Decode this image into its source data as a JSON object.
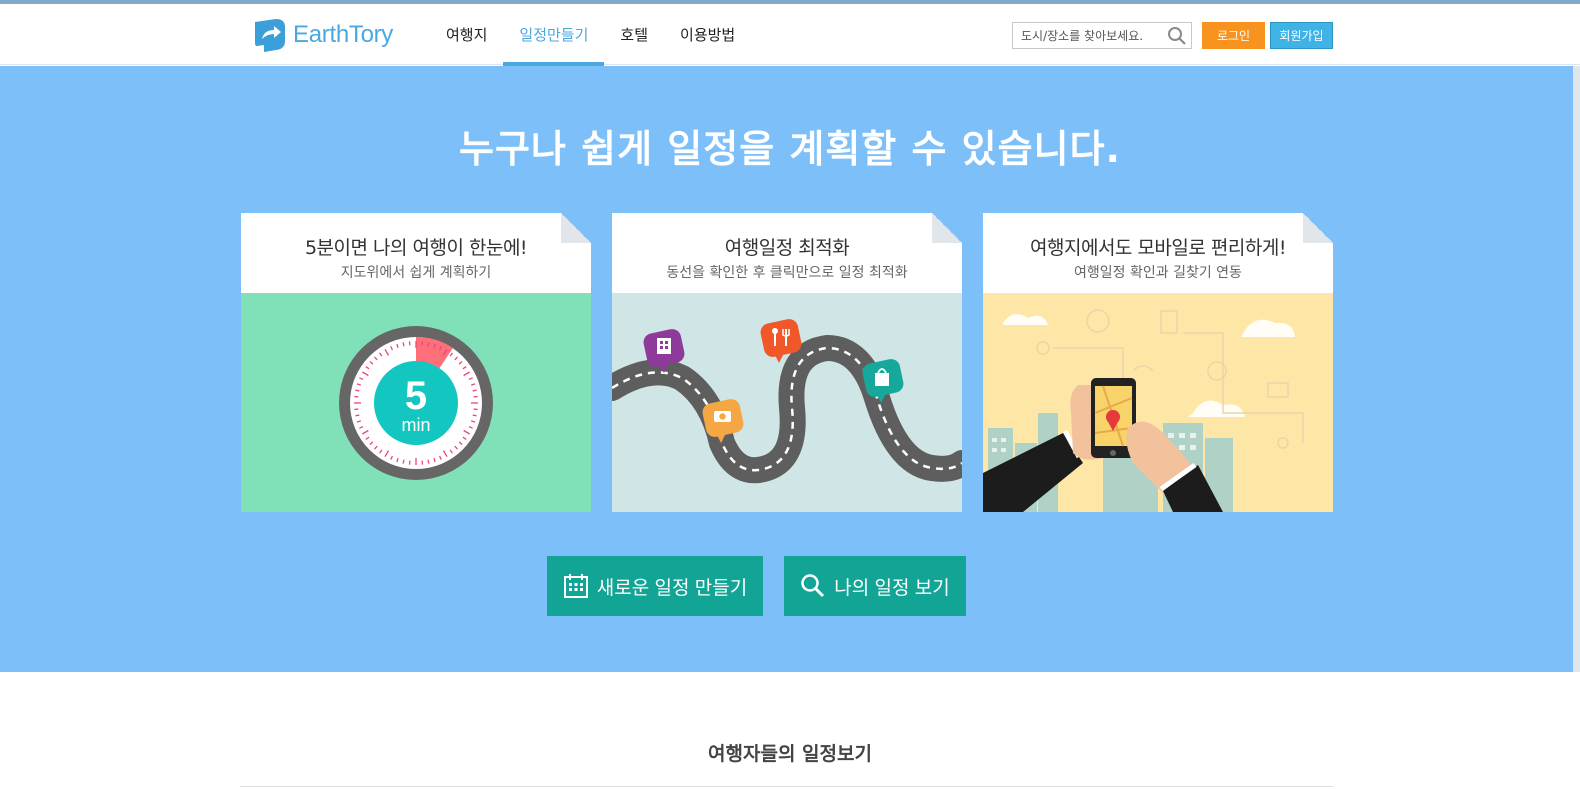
{
  "header": {
    "logo_text": "EarthTory",
    "nav": [
      {
        "label": "여행지"
      },
      {
        "label": "일정만들기"
      },
      {
        "label": "호텔"
      },
      {
        "label": "이용방법"
      }
    ],
    "active_nav": "일정만들기",
    "search_placeholder": "도시/장소를 찾아보세요.",
    "login_label": "로그인",
    "join_label": "회원가입"
  },
  "hero": {
    "title": "누구나 쉽게 일정을 계획할 수 있습니다.",
    "cards": [
      {
        "title": "5분이면 나의 여행이 한눈에!",
        "subtitle": "지도위에서 쉽게 계획하기",
        "timer_number": "5",
        "timer_unit": "min"
      },
      {
        "title": "여행일정 최적화",
        "subtitle": "동선을 확인한 후 클릭만으로 일정 최적화"
      },
      {
        "title": "여행지에서도 모바일로 편리하게!",
        "subtitle": "여행일정 확인과 길찾기 연동"
      }
    ],
    "buttons": {
      "new_plan": "새로운 일정 만들기",
      "my_plan": "나의 일정 보기"
    }
  },
  "section": {
    "title": "여행자들의 일정보기"
  },
  "colors": {
    "hero_bg": "#7cbff9",
    "brand": "#4aa8df",
    "cta": "#12a596",
    "login": "#f7931e",
    "join": "#3fb2e6",
    "card1_bg": "#80e0b7",
    "card2_bg": "#d0e6e6",
    "card3_bg": "#fde6a6"
  }
}
